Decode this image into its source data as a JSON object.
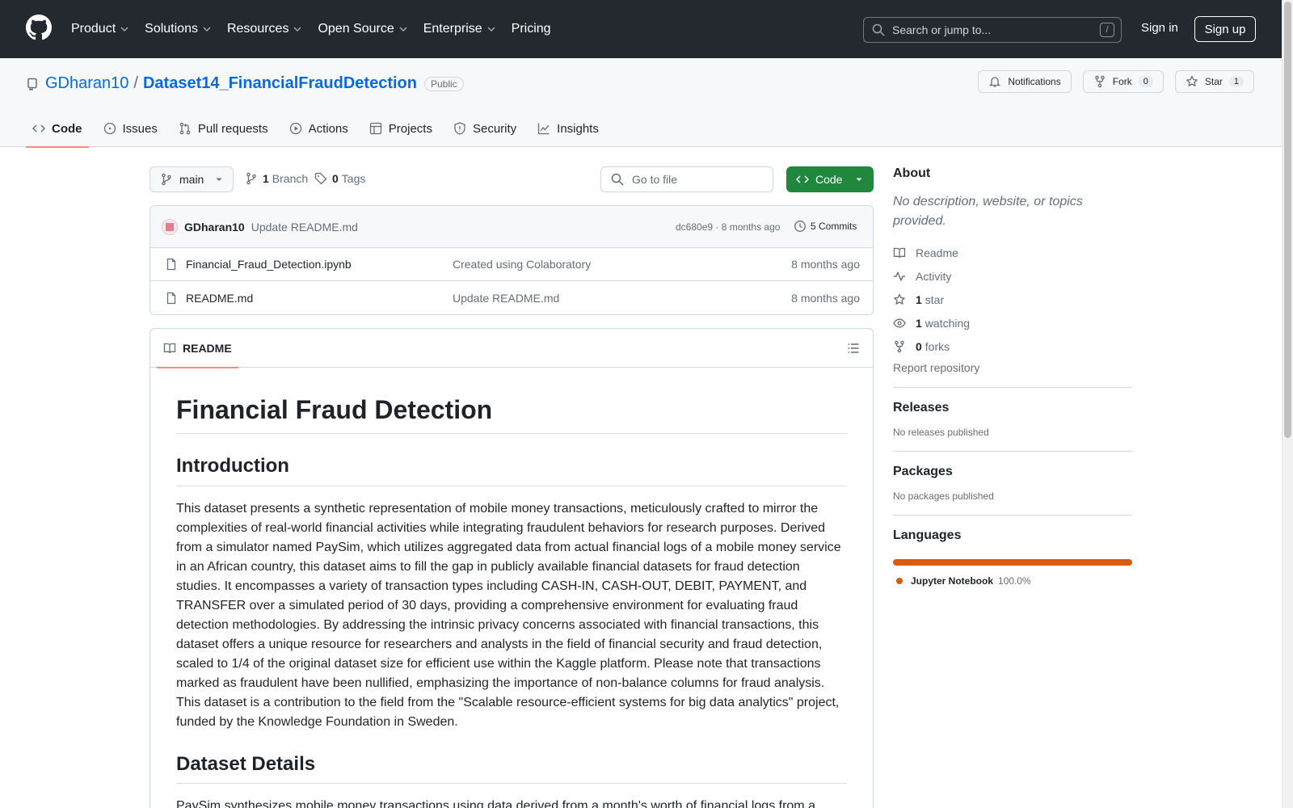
{
  "header": {
    "nav": [
      "Product",
      "Solutions",
      "Resources",
      "Open Source",
      "Enterprise",
      "Pricing"
    ],
    "search_placeholder": "Search or jump to...",
    "search_shortcut": "/",
    "signin": "Sign in",
    "signup": "Sign up"
  },
  "repo": {
    "owner": "GDharan10",
    "separator": "/",
    "name": "Dataset14_FinancialFraudDetection",
    "visibility": "Public",
    "notifications": "Notifications",
    "fork_label": "Fork",
    "fork_count": "0",
    "star_label": "Star",
    "star_count": "1",
    "tabs": [
      "Code",
      "Issues",
      "Pull requests",
      "Actions",
      "Projects",
      "Security",
      "Insights"
    ]
  },
  "toolbar": {
    "branch": "main",
    "branch_count": "1",
    "branch_label": "Branch",
    "tag_count": "0",
    "tag_label": "Tags",
    "goto_placeholder": "Go to file",
    "code_label": "Code"
  },
  "commit": {
    "author": "GDharan10",
    "message": "Update README.md",
    "meta": "dc680e9 · 8 months ago",
    "commits": "5 Commits"
  },
  "files": [
    {
      "name": "Financial_Fraud_Detection.ipynb",
      "message": "Created using Colaboratory",
      "age": "8 months ago"
    },
    {
      "name": "README.md",
      "message": "Update README.md",
      "age": "8 months ago"
    }
  ],
  "readme": {
    "tab": "README",
    "h1": "Financial Fraud Detection",
    "h2_intro": "Introduction",
    "intro_p": "This dataset presents a synthetic representation of mobile money transactions, meticulously crafted to mirror the complexities of real-world financial activities while integrating fraudulent behaviors for research purposes. Derived from a simulator named PaySim, which utilizes aggregated data from actual financial logs of a mobile money service in an African country, this dataset aims to fill the gap in publicly available financial datasets for fraud detection studies. It encompasses a variety of transaction types including CASH-IN, CASH-OUT, DEBIT, PAYMENT, and TRANSFER over a simulated period of 30 days, providing a comprehensive environment for evaluating fraud detection methodologies. By addressing the intrinsic privacy concerns associated with financial transactions, this dataset offers a unique resource for researchers and analysts in the field of financial security and fraud detection, scaled to 1/4 of the original dataset size for efficient use within the Kaggle platform. Please note that transactions marked as fraudulent have been nullified, emphasizing the importance of non-balance columns for fraud analysis. This dataset is a contribution to the field from the \"Scalable resource-efficient systems for big data analytics\" project, funded by the Knowledge Foundation in Sweden.",
    "h2_details": "Dataset Details",
    "details_p": "PaySim synthesizes mobile money transactions using data derived from a month's worth of financial logs from a"
  },
  "sidebar": {
    "about_title": "About",
    "about_desc": "No description, website, or topics provided.",
    "readme": "Readme",
    "activity": "Activity",
    "stars_count": "1",
    "stars_label": "star",
    "watching_count": "1",
    "watching_label": "watching",
    "forks_count": "0",
    "forks_label": "forks",
    "report": "Report repository",
    "releases_title": "Releases",
    "releases_text": "No releases published",
    "packages_title": "Packages",
    "packages_text": "No packages published",
    "languages_title": "Languages",
    "language_name": "Jupyter Notebook",
    "language_pct": "100.0%",
    "language_color": "#DA5B0B"
  }
}
